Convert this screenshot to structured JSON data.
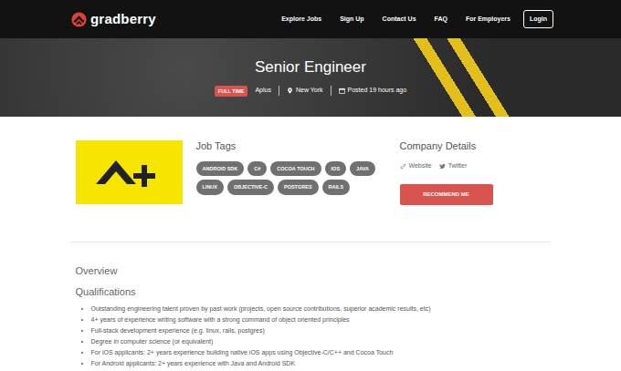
{
  "nav": {
    "brand": "gradberry",
    "links": [
      "Explore Jobs",
      "Sign Up",
      "Contact Us",
      "FAQ",
      "For Employers"
    ],
    "login": "Login"
  },
  "job": {
    "title": "Senior Engineer",
    "type": "FULL TIME",
    "company": "Aplus",
    "location": "New York",
    "posted": "Posted 19 hours ago"
  },
  "tags": {
    "heading": "Job Tags",
    "items": [
      "ANDROID SDK",
      "C#",
      "COCOA TOUCH",
      "IOS",
      "JAVA",
      "LINUX",
      "OBJECTIVE-C",
      "POSTGRES",
      "RAILS"
    ]
  },
  "company_details": {
    "heading": "Company Details",
    "website": "Website",
    "twitter": "Twitter",
    "button": "RECOMMEND ME"
  },
  "overview": {
    "heading": "Overview",
    "subheading": "Qualifications",
    "items": [
      "Outstanding engineering talent proven by past work (projects, open source contributions, superior academic results, etc)",
      "4+ years of experience writing software with a strong command of object oriented principles",
      "Full-stack development experience (e.g. linux, rails, postgres)",
      "Degree in computer science (or equivalent)",
      "For iOS applicants: 2+ years experience building native iOS apps using Objective-C/C++ and Cocoa Touch",
      "For Android applicants: 2+ years experience with Java and Android SDK"
    ]
  }
}
